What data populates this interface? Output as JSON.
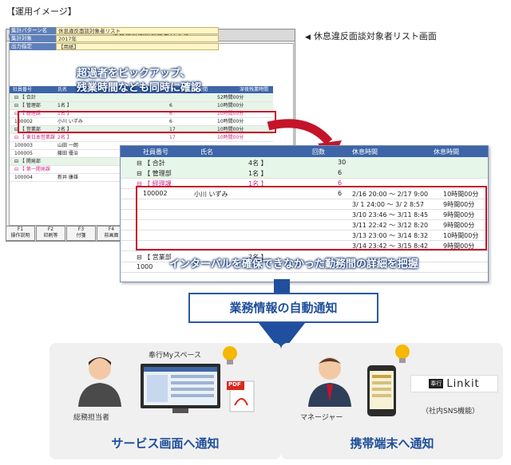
{
  "page": {
    "heading": "【運用イメージ】",
    "screen_caption": "休息違反面談対象者リスト画面",
    "screen_caption_marker": "◀"
  },
  "back_window": {
    "title": "休息違反面談対象者リスト",
    "info_rows": [
      {
        "key": "集計パターン名",
        "value": "休息違反面談対象者リスト"
      },
      {
        "key": "集計対象",
        "value": "2017年"
      },
      {
        "key": "出力指定",
        "value": "【用紙】"
      }
    ],
    "columns": [
      "社員番号",
      "氏名",
      "回数",
      "時間",
      "深夜残業時間"
    ],
    "rows": [
      {
        "a": "⊟ 【 合計",
        "b": "",
        "c": "",
        "d": "52時間00分",
        "g": true
      },
      {
        "a": "  ⊟ 【 管理部",
        "b": "1名 】",
        "c": "6",
        "d": "10時間00分",
        "g": true
      },
      {
        "a": "    ⊟ 【 経理課",
        "b": "1名 】",
        "c": "6",
        "d": "10時間00分",
        "pink": true
      },
      {
        "a": "    100002",
        "b": "小川 いずみ",
        "c": "6",
        "d": "10時間00分"
      },
      {
        "a": "  ⊟ 【 営業部",
        "b": "2名 】",
        "c": "17",
        "d": "10時間00分",
        "g": true
      },
      {
        "a": "    ⊟ 【 東日本営業課",
        "b": "2名 】",
        "c": "17",
        "d": "10時間00分",
        "pink": true
      },
      {
        "a": "    100003",
        "b": "山田 一朗",
        "c": "",
        "d": ""
      },
      {
        "a": "    100005",
        "b": "藤田 優治",
        "c": "",
        "d": ""
      },
      {
        "a": "  ⊟ 【 開発部",
        "b": "",
        "c": "",
        "d": "",
        "g": true
      },
      {
        "a": "    ⊟ 【 第一開発課",
        "b": "",
        "c": "",
        "d": "",
        "pink": true
      },
      {
        "a": "    100004",
        "b": "新井 康雄",
        "c": "",
        "d": ""
      }
    ],
    "fkeys": [
      {
        "key": "F1",
        "label": "操作説明"
      },
      {
        "key": "F2",
        "label": "印刷等"
      },
      {
        "key": "F3",
        "label": "付箋"
      },
      {
        "key": "F4",
        "label": "前画面"
      }
    ],
    "callout_line1": "超過者をピックアップ、",
    "callout_line2": "残業時間なども同時に確認"
  },
  "front_table": {
    "columns": [
      "社員番号",
      "氏名",
      "回数",
      "休息時間",
      "休息時間"
    ],
    "rows": [
      {
        "num": "⊟ 【 合計",
        "name": "4名 】",
        "count": "30",
        "g": true
      },
      {
        "num": "  ⊟ 【 管理部",
        "name": "1名 】",
        "count": "6",
        "g": true
      },
      {
        "num": "    ⊟ 【 経理課",
        "name": "1名 】",
        "count": "6",
        "pink": true
      }
    ],
    "employee": {
      "num": "100002",
      "name": "小川 いずみ",
      "count": "6"
    },
    "details": [
      {
        "period": "2/16 20:00 〜 2/17  9:00",
        "rest": "10時間00分"
      },
      {
        "period": "3/ 1 24:00 〜 3/ 2  8:57",
        "rest": "9時間00分"
      },
      {
        "period": "3/10 23:46 〜 3/11  8:45",
        "rest": "9時間00分"
      },
      {
        "period": "3/11 22:42 〜 3/12  8:20",
        "rest": "9時間00分"
      },
      {
        "period": "3/13 23:00 〜 3/14  8:32",
        "rest": "10時間00分"
      },
      {
        "period": "3/14 23:42 〜 3/15  8:42",
        "rest": "9時間00分"
      }
    ],
    "tail_rows": [
      {
        "num": "  ⊟ 【 営業部",
        "name": "2名 】"
      },
      {
        "num": "    1000",
        "name": ""
      }
    ],
    "callout": "インターバルを確保できなかった勤務間の詳細を把握"
  },
  "notice": "業務情報の自動通知",
  "left_panel": {
    "person_label": "総務担当者",
    "app_label": "奉行Myスペース",
    "pdf_label": "PDF",
    "title": "サービス画面へ通知"
  },
  "right_panel": {
    "person_label": "マネージャー",
    "logo_prefix": "奉行",
    "logo_text": "Linkit",
    "logo_note": "（社内SNS機能）",
    "title": "携帯端末へ通知"
  },
  "colors": {
    "accent_blue": "#1e4e9a",
    "alert_red": "#c4142a",
    "header_blue": "#3e65a8",
    "bulb_yellow": "#f6b800"
  }
}
